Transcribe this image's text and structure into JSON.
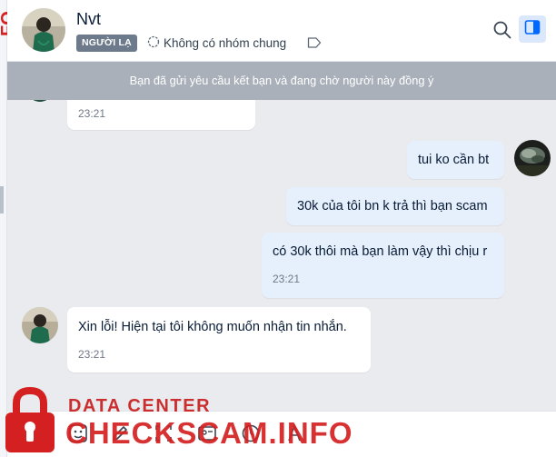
{
  "watermark": {
    "side_text": "FO",
    "data_center": "DATA CENTER",
    "brand": "CHECKSCAM.INFO"
  },
  "header": {
    "contact_name": "Nvt",
    "badge": "NGƯỜI LẠ",
    "group_text": "Không có nhóm chung"
  },
  "banner": {
    "text": "Bạn đã gửi yêu cầu kết bạn và đang chờ người này đồng ý"
  },
  "messages": [
    {
      "direction": "in",
      "text": "",
      "time": "23:21"
    },
    {
      "direction": "out",
      "text": "tui ko cần bt",
      "time": ""
    },
    {
      "direction": "out",
      "text": "30k của tôi bn k trả thì bạn scam",
      "time": ""
    },
    {
      "direction": "out",
      "text": "có 30k thôi mà bạn làm vậy thì chịu r",
      "time": "23:21"
    },
    {
      "direction": "in",
      "text": "Xin lỗi! Hiện tại tôi không muốn nhận tin nhắn.",
      "time": "23:21"
    }
  ],
  "colors": {
    "incoming_bubble": "#ffffff",
    "outgoing_bubble": "#e6effc",
    "banner": "#a9b0ba",
    "stranger_badge": "#6c7a8b",
    "watermark_red": "#d42020"
  },
  "icons": {
    "header": [
      "search-icon",
      "sidebar-toggle-icon",
      "tag-icon",
      "group-icon"
    ],
    "toolbar": [
      "sticker-icon",
      "image-icon",
      "pen-icon",
      "screenshot-icon",
      "card-icon",
      "clock-icon",
      "text-format-icon"
    ]
  }
}
